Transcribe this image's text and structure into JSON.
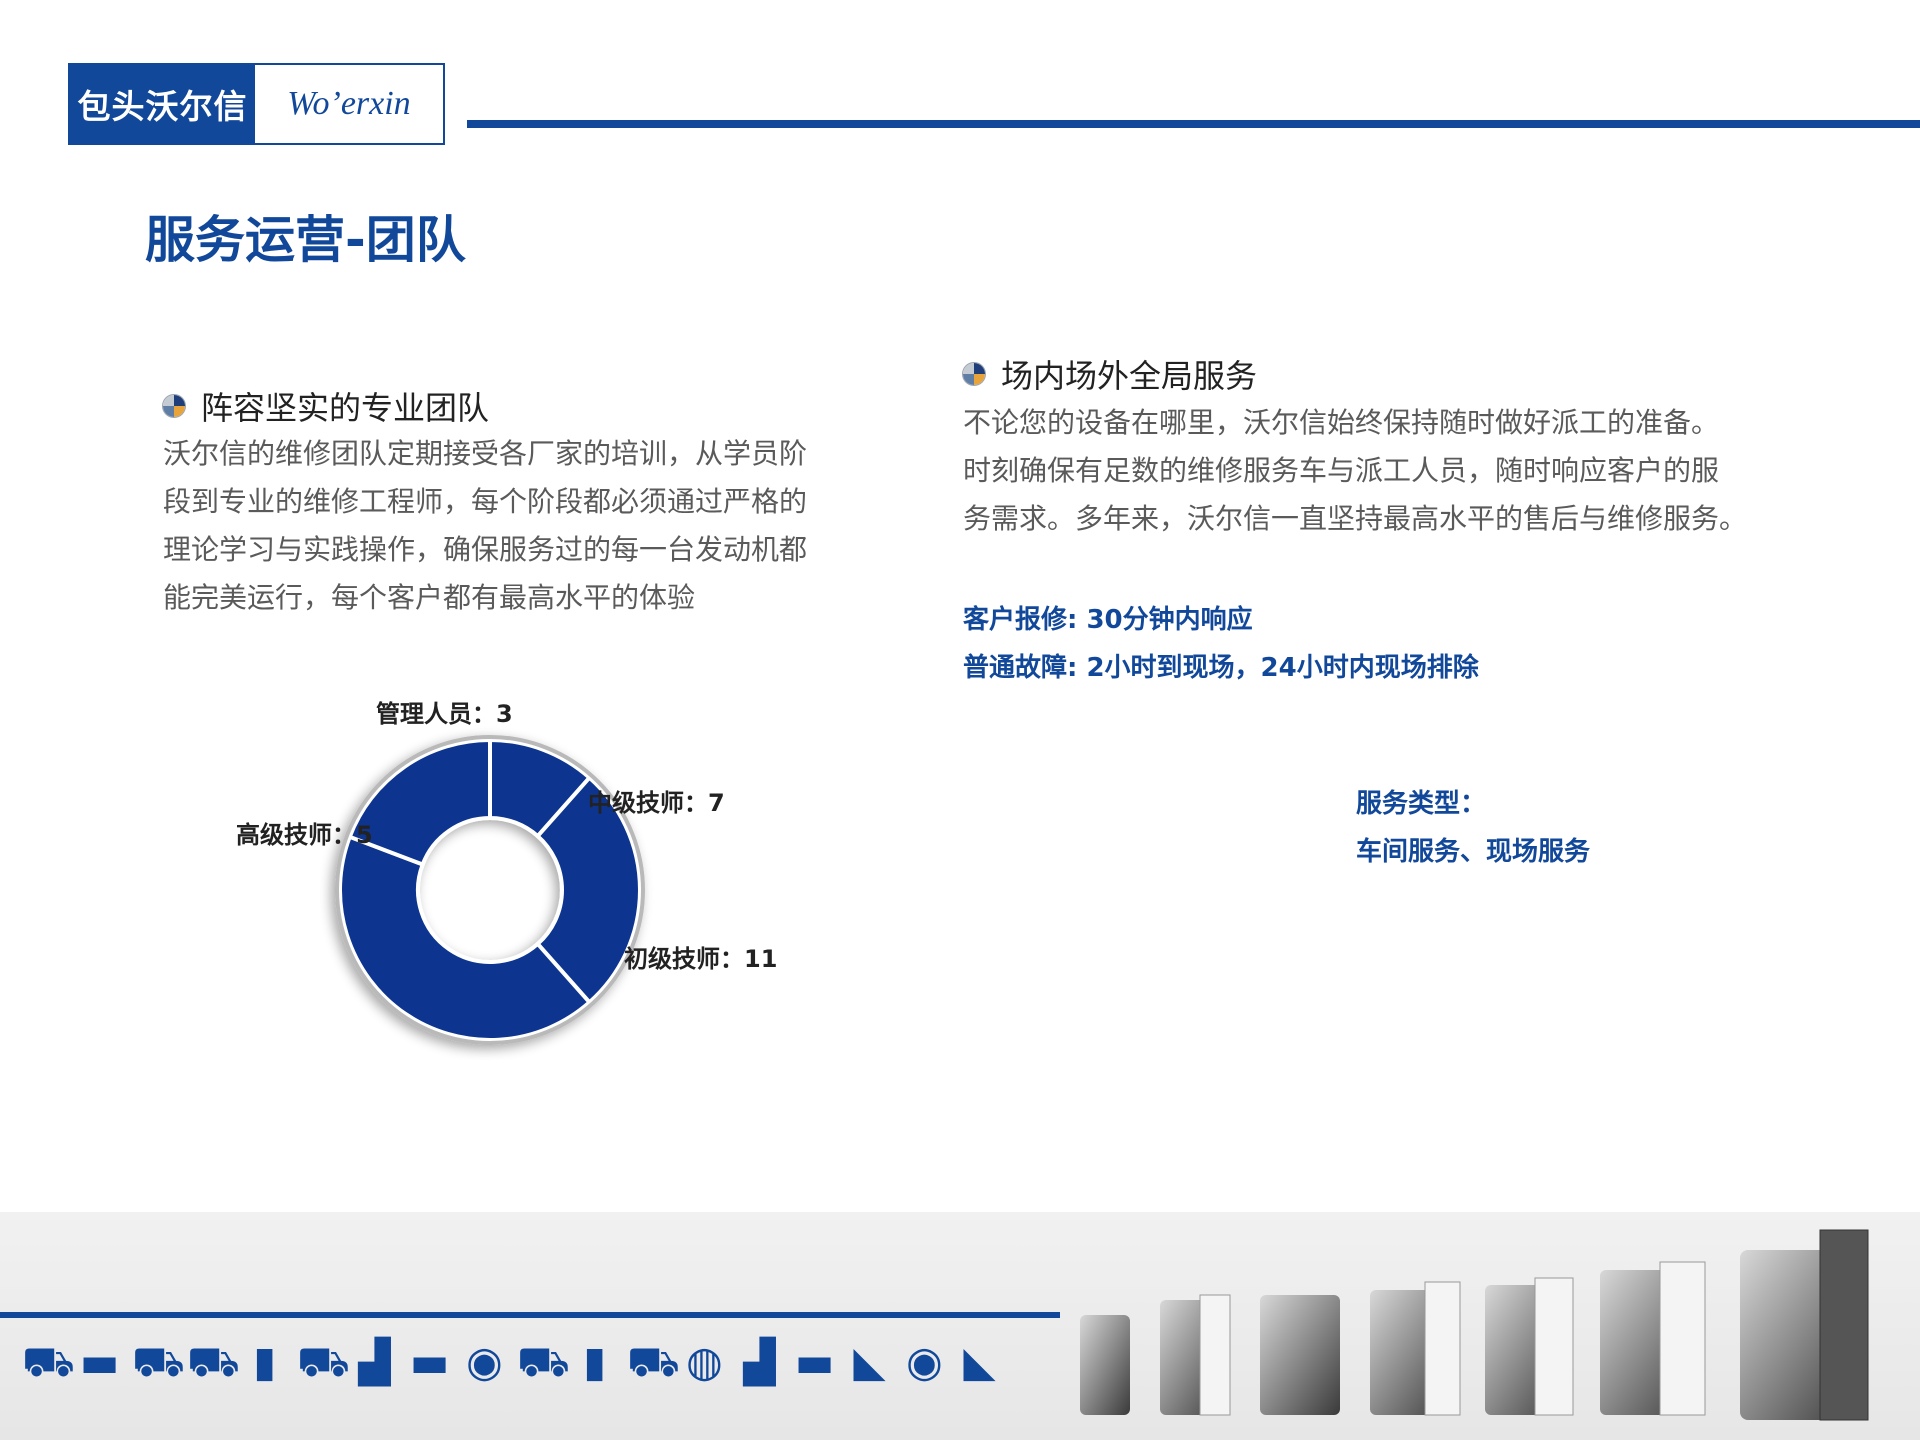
{
  "logo": {
    "cn": "包头沃尔信",
    "en": "Wo’erxin"
  },
  "page_title": "服务运营-团队",
  "section_left": {
    "heading": "阵容坚实的专业团队",
    "lines": [
      "沃尔信的维修团队定期接受各厂家的培训，从学员阶",
      "段到专业的维修工程师，每个阶段都必须通过严格的",
      "理论学习与实践操作，确保服务过的每一台发动机都",
      "能完美运行，每个客户都有最高水平的体验"
    ]
  },
  "section_right": {
    "heading": "场内场外全局服务",
    "lines": [
      "不论您的设备在哪里，沃尔信始终保持随时做好派工的准备。",
      "时刻确保有足数的维修服务车与派工人员，随时响应客户的服",
      "务需求。多年来，沃尔信一直坚持最高水平的售后与维修服务。"
    ],
    "highlights": [
      "客户报修: 30分钟内响应",
      "普通故障: 2小时到现场，24小时内现场排除"
    ],
    "service_type_label": "服务类型：",
    "service_type_value": "车间服务、现场服务"
  },
  "chart_data": {
    "type": "pie",
    "variant": "donut",
    "color": "#0a3590",
    "slices": [
      {
        "label": "管理人员：3",
        "value": 3
      },
      {
        "label": "中级技师：7",
        "value": 7
      },
      {
        "label": "初级技师：11",
        "value": 11
      },
      {
        "label": "高级技师：5",
        "value": 5
      }
    ]
  },
  "footer": {
    "vehicle_icons": [
      "fuel-truck-icon",
      "bus-icon",
      "tow-truck-icon",
      "tanker-truck-icon",
      "box-truck-icon",
      "pickup-truck-icon",
      "forklift-icon",
      "coach-bus-icon",
      "tractor-icon",
      "semi-truck-icon",
      "cargo-truck-icon",
      "crane-truck-icon",
      "mixer-truck-icon",
      "loader-icon",
      "van-icon",
      "excavator-icon",
      "road-roller-icon",
      "wheel-loader-icon"
    ],
    "engine_icons": [
      "engine-1",
      "engine-2",
      "engine-3",
      "engine-4",
      "engine-5",
      "engine-6",
      "engine-7"
    ]
  }
}
